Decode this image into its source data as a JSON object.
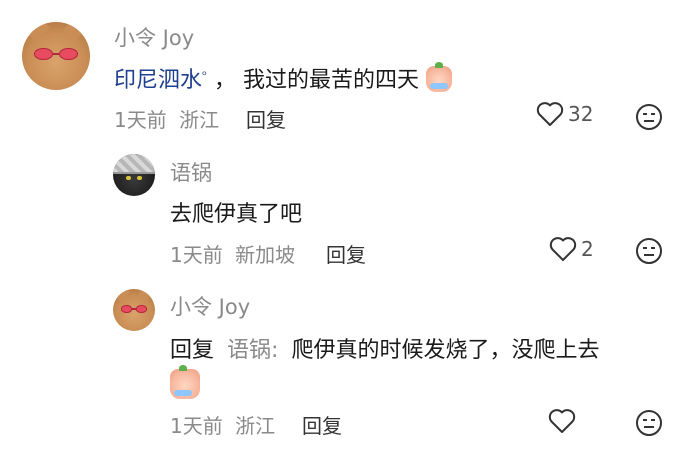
{
  "comments": [
    {
      "username": "小令 Joy",
      "content_link": "印尼泗水",
      "content_rest": "，  我过的最苦的四天",
      "date": "1天前",
      "location": "浙江",
      "reply_label": "回复",
      "likes": "32",
      "emoji": "crying-peach-emoji",
      "replies": [
        {
          "username": "语锅",
          "content": "去爬伊真了吧",
          "date": "1天前",
          "location": "新加坡",
          "reply_label": "回复",
          "likes": "2"
        },
        {
          "username": "小令 Joy",
          "reply_prefix": "回复",
          "mention": "语锅:",
          "content": "爬伊真的时候发烧了，没爬上去",
          "date": "1天前",
          "location": "浙江",
          "reply_label": "回复",
          "likes": "",
          "emoji": "crying-peach-emoji"
        }
      ]
    }
  ]
}
